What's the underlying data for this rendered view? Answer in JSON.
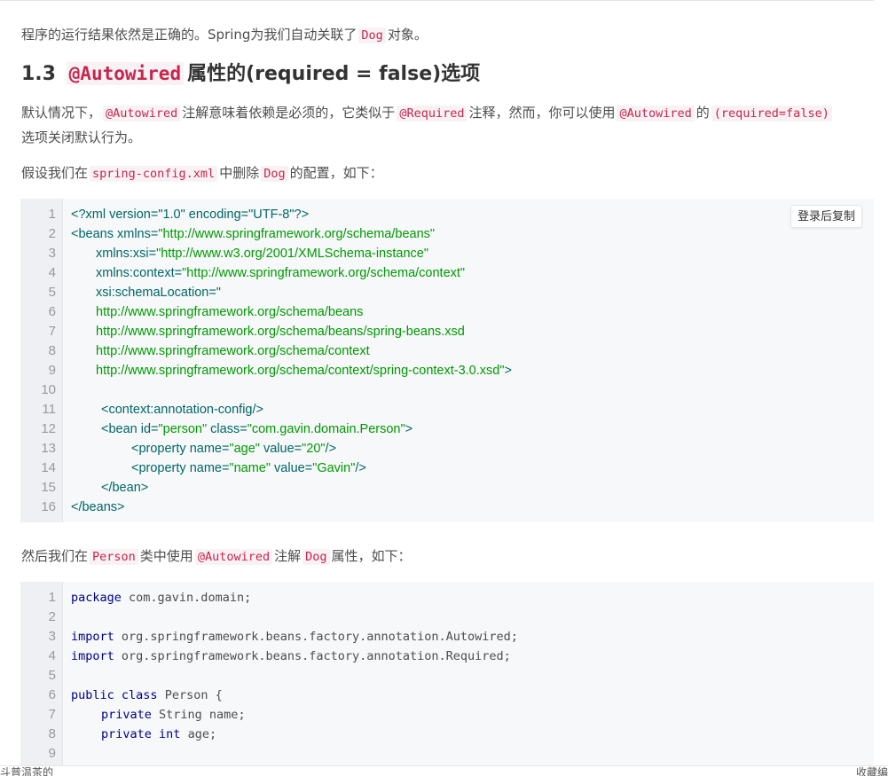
{
  "intro": {
    "text_before": "程序的运行结果依然是正确的。Spring为我们自动关联了",
    "code": "Dog",
    "text_after": "对象。"
  },
  "section": {
    "number": "1.3",
    "code": "@Autowired",
    "title_rest": "属性的(required = false)选项"
  },
  "para1": {
    "t1": "默认情况下，",
    "c1": "@Autowired",
    "t2": "注解意味着依赖是必须的，它类似于",
    "c2": "@Required",
    "t3": "注释，然而，你可以使用",
    "c3": "@Autowired",
    "t4": "的",
    "c4": "(required=false)",
    "t5": "选项关闭默认行为。"
  },
  "para2": {
    "t1": "假设我们在",
    "c1": "spring-config.xml",
    "t2": "中删除",
    "c2": "Dog",
    "t3": "的配置，如下："
  },
  "copy_button": {
    "label": "登录后复制"
  },
  "xml_code": {
    "lines": [
      {
        "n": "1",
        "indent": 0,
        "parts": [
          [
            "tag",
            "<?xml version=\"1.0\" encoding=\"UTF-8\"?>"
          ]
        ]
      },
      {
        "n": "2",
        "indent": 0,
        "parts": [
          [
            "tag",
            "<beans xmlns="
          ],
          [
            "str",
            "\"http://www.springframework.org/schema/beans\""
          ]
        ]
      },
      {
        "n": "3",
        "indent": 1,
        "parts": [
          [
            "tag",
            "xmlns:xsi="
          ],
          [
            "str",
            "\"http://www.w3.org/2001/XMLSchema-instance\""
          ]
        ]
      },
      {
        "n": "4",
        "indent": 1,
        "parts": [
          [
            "tag",
            "xmlns:context="
          ],
          [
            "str",
            "\"http://www.springframework.org/schema/context\""
          ]
        ]
      },
      {
        "n": "5",
        "indent": 1,
        "parts": [
          [
            "tag",
            "xsi:schemaLocation=\""
          ]
        ]
      },
      {
        "n": "6",
        "indent": 1,
        "parts": [
          [
            "str",
            "http://www.springframework.org/schema/beans"
          ]
        ]
      },
      {
        "n": "7",
        "indent": 1,
        "parts": [
          [
            "str",
            "http://www.springframework.org/schema/beans/spring-beans.xsd"
          ]
        ]
      },
      {
        "n": "8",
        "indent": 1,
        "parts": [
          [
            "str",
            "http://www.springframework.org/schema/context"
          ]
        ]
      },
      {
        "n": "9",
        "indent": 1,
        "parts": [
          [
            "str",
            "http://www.springframework.org/schema/context/spring-context-3.0.xsd\""
          ],
          [
            "tag",
            ">"
          ]
        ]
      },
      {
        "n": "10",
        "indent": 0,
        "parts": []
      },
      {
        "n": "11",
        "indent": 2,
        "parts": [
          [
            "tag",
            "<context:annotation-config/>"
          ]
        ]
      },
      {
        "n": "12",
        "indent": 2,
        "parts": [
          [
            "tag",
            "<bean id="
          ],
          [
            "str",
            "\"person\""
          ],
          [
            "tag",
            " class="
          ],
          [
            "str",
            "\"com.gavin.domain.Person\""
          ],
          [
            "tag",
            ">"
          ]
        ]
      },
      {
        "n": "13",
        "indent": 3,
        "parts": [
          [
            "tag",
            "<property name="
          ],
          [
            "str",
            "\"age\""
          ],
          [
            "tag",
            " value="
          ],
          [
            "str",
            "\"20\""
          ],
          [
            "tag",
            "/>"
          ]
        ]
      },
      {
        "n": "14",
        "indent": 3,
        "parts": [
          [
            "tag",
            "<property name="
          ],
          [
            "str",
            "\"name\""
          ],
          [
            "tag",
            " value="
          ],
          [
            "str",
            "\"Gavin\""
          ],
          [
            "tag",
            "/>"
          ]
        ]
      },
      {
        "n": "15",
        "indent": 2,
        "parts": [
          [
            "tag",
            "</bean>"
          ]
        ]
      },
      {
        "n": "16",
        "indent": 0,
        "parts": [
          [
            "tag",
            "</beans>"
          ]
        ]
      }
    ]
  },
  "para3": {
    "t1": "然后我们在",
    "c1": "Person",
    "t2": "类中使用",
    "c2": "@Autowired",
    "t3": "注解",
    "c3": "Dog",
    "t4": "属性，如下："
  },
  "java_code": {
    "lines": [
      {
        "n": "1",
        "indent": 0,
        "parts": [
          [
            "kw",
            "package"
          ],
          [
            "plain",
            " com.gavin.domain;"
          ]
        ]
      },
      {
        "n": "2",
        "indent": 0,
        "parts": []
      },
      {
        "n": "3",
        "indent": 0,
        "parts": [
          [
            "kw",
            "import"
          ],
          [
            "plain",
            " org.springframework.beans.factory.annotation.Autowired;"
          ]
        ]
      },
      {
        "n": "4",
        "indent": 0,
        "parts": [
          [
            "kw",
            "import"
          ],
          [
            "plain",
            " org.springframework.beans.factory.annotation.Required;"
          ]
        ]
      },
      {
        "n": "5",
        "indent": 0,
        "parts": []
      },
      {
        "n": "6",
        "indent": 0,
        "parts": [
          [
            "kw",
            "public"
          ],
          [
            "plain",
            " "
          ],
          [
            "kw",
            "class"
          ],
          [
            "plain",
            " Person {"
          ]
        ]
      },
      {
        "n": "7",
        "indent": 1,
        "parts": [
          [
            "kw",
            "private"
          ],
          [
            "plain",
            " String name;"
          ]
        ]
      },
      {
        "n": "8",
        "indent": 1,
        "parts": [
          [
            "kw",
            "private"
          ],
          [
            "plain",
            " "
          ],
          [
            "kw",
            "int"
          ],
          [
            "plain",
            " age;"
          ]
        ]
      },
      {
        "n": "9",
        "indent": 0,
        "parts": []
      }
    ]
  },
  "bottom_bar": {
    "left_text": "斗普温茶的",
    "right_text": "收藏编"
  }
}
